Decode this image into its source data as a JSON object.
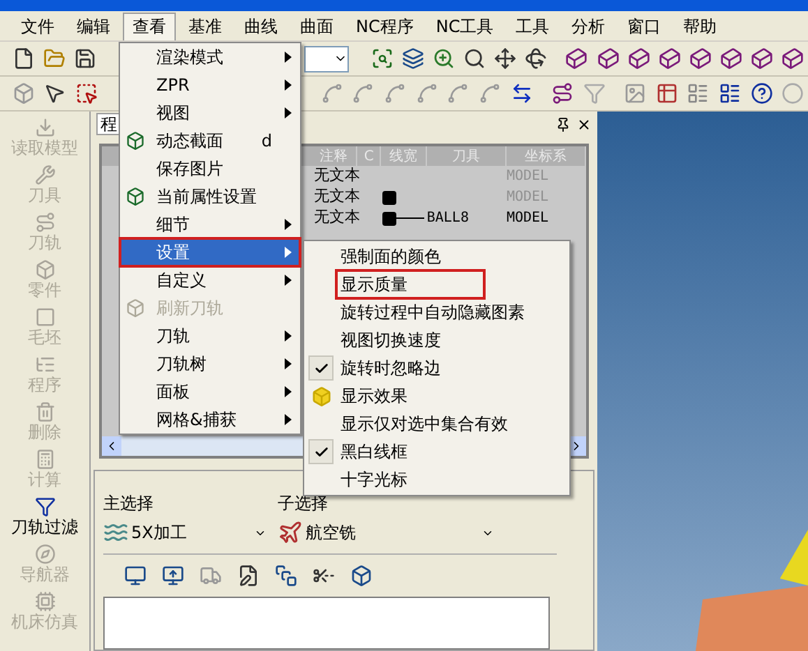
{
  "menu_bar": [
    {
      "label": "文件",
      "selected": false
    },
    {
      "label": "编辑",
      "selected": false
    },
    {
      "label": "查看",
      "selected": true
    },
    {
      "label": "基准",
      "selected": false
    },
    {
      "label": "曲线",
      "selected": false
    },
    {
      "label": "曲面",
      "selected": false
    },
    {
      "label": "NC程序",
      "selected": false
    },
    {
      "label": "NC工具",
      "selected": false
    },
    {
      "label": "工具",
      "selected": false
    },
    {
      "label": "分析",
      "selected": false
    },
    {
      "label": "窗口",
      "selected": false
    },
    {
      "label": "帮助",
      "selected": false
    }
  ],
  "sidebar": [
    {
      "label": "读取模型",
      "disabled": true
    },
    {
      "label": "刀具",
      "disabled": true
    },
    {
      "label": "刀轨",
      "disabled": true
    },
    {
      "label": "零件",
      "disabled": true
    },
    {
      "label": "毛坯",
      "disabled": true
    },
    {
      "label": "程序",
      "disabled": true
    },
    {
      "label": "删除",
      "disabled": true
    },
    {
      "label": "计算",
      "disabled": true
    },
    {
      "label": "刀轨过滤",
      "disabled": false
    },
    {
      "label": "导航器",
      "disabled": true
    },
    {
      "label": "机床仿真",
      "disabled": true
    }
  ],
  "panel": {
    "title": "程",
    "columns": [
      "注释",
      "C",
      "线宽",
      "刀具",
      "坐标系"
    ],
    "rows": [
      {
        "note": "无文本",
        "swatch": false,
        "line": false,
        "coord": "MODEL",
        "dimmed": true
      },
      {
        "note": "无文本",
        "swatch": true,
        "line": false,
        "coord": "MODEL",
        "dimmed": true
      },
      {
        "note": "无文本",
        "swatch": true,
        "line": true,
        "tool": "BALL8",
        "coord": "MODEL",
        "dimmed": false
      }
    ],
    "main_select": {
      "label": "主选择",
      "value": "5X加工"
    },
    "sub_select": {
      "label": "子选择",
      "value": "航空铣"
    }
  },
  "view_menu": [
    {
      "kind": "submenu",
      "label": "渲染模式",
      "selected": false,
      "disabled": false,
      "outlined": false
    },
    {
      "kind": "submenu",
      "label": "ZPR",
      "selected": false,
      "disabled": false,
      "outlined": false
    },
    {
      "kind": "submenu",
      "label": "视图",
      "selected": false,
      "disabled": false,
      "outlined": false
    },
    {
      "kind": "icon",
      "label": "动态截面",
      "shortcut": "d",
      "selected": false,
      "disabled": false,
      "outlined": false
    },
    {
      "kind": "command",
      "label": "保存图片",
      "selected": false,
      "disabled": false,
      "outlined": false
    },
    {
      "kind": "icon",
      "label": "当前属性设置",
      "selected": false,
      "disabled": false,
      "outlined": false
    },
    {
      "kind": "submenu",
      "label": "细节",
      "selected": false,
      "disabled": false,
      "outlined": false
    },
    {
      "kind": "submenu",
      "label": "设置",
      "selected": true,
      "disabled": false,
      "outlined": true
    },
    {
      "kind": "submenu",
      "label": "自定义",
      "selected": false,
      "disabled": false,
      "outlined": false
    },
    {
      "kind": "icon",
      "label": "刷新刀轨",
      "selected": false,
      "disabled": true,
      "outlined": false
    },
    {
      "kind": "submenu",
      "label": "刀轨",
      "selected": false,
      "disabled": false,
      "outlined": false
    },
    {
      "kind": "submenu",
      "label": "刀轨树",
      "selected": false,
      "disabled": false,
      "outlined": false
    },
    {
      "kind": "submenu",
      "label": "面板",
      "selected": false,
      "disabled": false,
      "outlined": false
    },
    {
      "kind": "submenu",
      "label": "网格&捕获",
      "selected": false,
      "disabled": false,
      "outlined": false
    }
  ],
  "settings_menu": [
    {
      "kind": "plain",
      "label": "强制面的颜色",
      "checked": false,
      "outlined": false
    },
    {
      "kind": "plain",
      "label": "显示质量",
      "checked": false,
      "outlined": true
    },
    {
      "kind": "plain",
      "label": "旋转过程中自动隐藏图素",
      "checked": false,
      "outlined": false
    },
    {
      "kind": "plain",
      "label": "视图切换速度",
      "checked": false,
      "outlined": false
    },
    {
      "kind": "plain",
      "label": "旋转时忽略边",
      "checked": true,
      "outlined": false
    },
    {
      "kind": "icon",
      "label": "显示效果",
      "checked": false,
      "outlined": false
    },
    {
      "kind": "plain",
      "label": "显示仅对选中集合有效",
      "checked": false,
      "outlined": false
    },
    {
      "kind": "plain",
      "label": "黑白线框",
      "checked": true,
      "outlined": false
    },
    {
      "kind": "plain",
      "label": "十字光标",
      "checked": false,
      "outlined": false
    }
  ]
}
